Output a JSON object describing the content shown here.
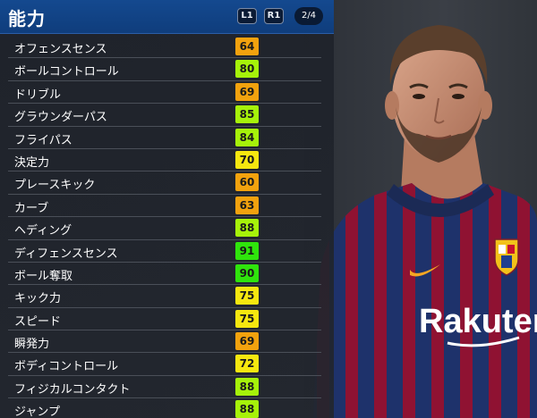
{
  "panel": {
    "title": "能力",
    "btn_l1": "L1",
    "btn_r1": "R1",
    "page": "2/4"
  },
  "rating_colors": {
    "orange": "#f2a20e",
    "yellow": "#f6e70f",
    "lime": "#a6f20a",
    "green": "#2fe40c"
  },
  "stats": [
    {
      "label": "オフェンスセンス",
      "value": "64",
      "tier": "orange"
    },
    {
      "label": "ボールコントロール",
      "value": "80",
      "tier": "lime"
    },
    {
      "label": "ドリブル",
      "value": "69",
      "tier": "orange"
    },
    {
      "label": "グラウンダーパス",
      "value": "85",
      "tier": "lime"
    },
    {
      "label": "フライパス",
      "value": "84",
      "tier": "lime"
    },
    {
      "label": "決定力",
      "value": "70",
      "tier": "yellow"
    },
    {
      "label": "プレースキック",
      "value": "60",
      "tier": "orange"
    },
    {
      "label": "カーブ",
      "value": "63",
      "tier": "orange"
    },
    {
      "label": "ヘディング",
      "value": "88",
      "tier": "lime"
    },
    {
      "label": "ディフェンスセンス",
      "value": "91",
      "tier": "green"
    },
    {
      "label": "ボール奪取",
      "value": "90",
      "tier": "green"
    },
    {
      "label": "キック力",
      "value": "75",
      "tier": "yellow"
    },
    {
      "label": "スピード",
      "value": "75",
      "tier": "yellow"
    },
    {
      "label": "瞬発力",
      "value": "69",
      "tier": "orange"
    },
    {
      "label": "ボディコントロール",
      "value": "72",
      "tier": "yellow"
    },
    {
      "label": "フィジカルコンタクト",
      "value": "88",
      "tier": "lime"
    },
    {
      "label": "ジャンプ",
      "value": "88",
      "tier": "lime"
    }
  ],
  "portrait": {
    "shirt_sponsor": "Rakuten",
    "shirt_colors": [
      "#a3153a",
      "#233a7a"
    ]
  }
}
